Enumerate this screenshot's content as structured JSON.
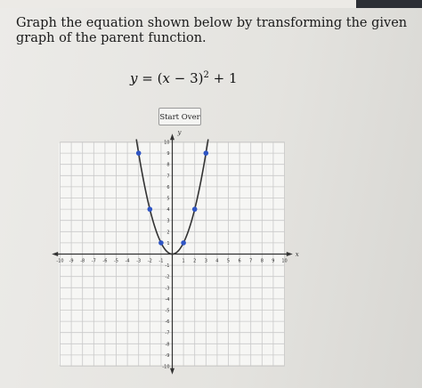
{
  "question": {
    "prompt": "Graph the equation shown below by transforming the given graph of the parent function.",
    "equation": {
      "lhs": "y",
      "eq": "=",
      "open": "(",
      "var": "x",
      "minus": "− 3",
      "close": ")",
      "exponent": "2",
      "plus": "+ 1"
    }
  },
  "controls": {
    "start_over_label": "Start Over"
  },
  "colors": {
    "grid_line": "#c9c9c9",
    "axis": "#333333",
    "curve": "#333333",
    "point": "#2f55c4",
    "graph_background": "#f6f6f4"
  },
  "chart_data": {
    "type": "scatter",
    "xlabel": "x",
    "ylabel": "y",
    "xlim": [
      -10,
      10
    ],
    "ylim": [
      -10,
      10
    ],
    "grid": true,
    "x_ticks": [
      -10,
      -9,
      -8,
      -7,
      -6,
      -5,
      -4,
      -3,
      -2,
      -1,
      1,
      2,
      3,
      4,
      5,
      6,
      7,
      8,
      9,
      10
    ],
    "y_ticks": [
      10,
      9,
      8,
      7,
      6,
      5,
      4,
      3,
      2,
      1,
      -1,
      -2,
      -3,
      -4,
      -5,
      -6,
      -7,
      -8,
      -9,
      -10
    ],
    "points": [
      {
        "x": -3,
        "y": 9
      },
      {
        "x": -2,
        "y": 4
      },
      {
        "x": -1,
        "y": 1
      },
      {
        "x": 1,
        "y": 1
      },
      {
        "x": 2,
        "y": 4
      },
      {
        "x": 3,
        "y": 9
      }
    ],
    "curve": {
      "function": "y = x^2",
      "x_range": [
        -3.2,
        3.2
      ]
    }
  }
}
